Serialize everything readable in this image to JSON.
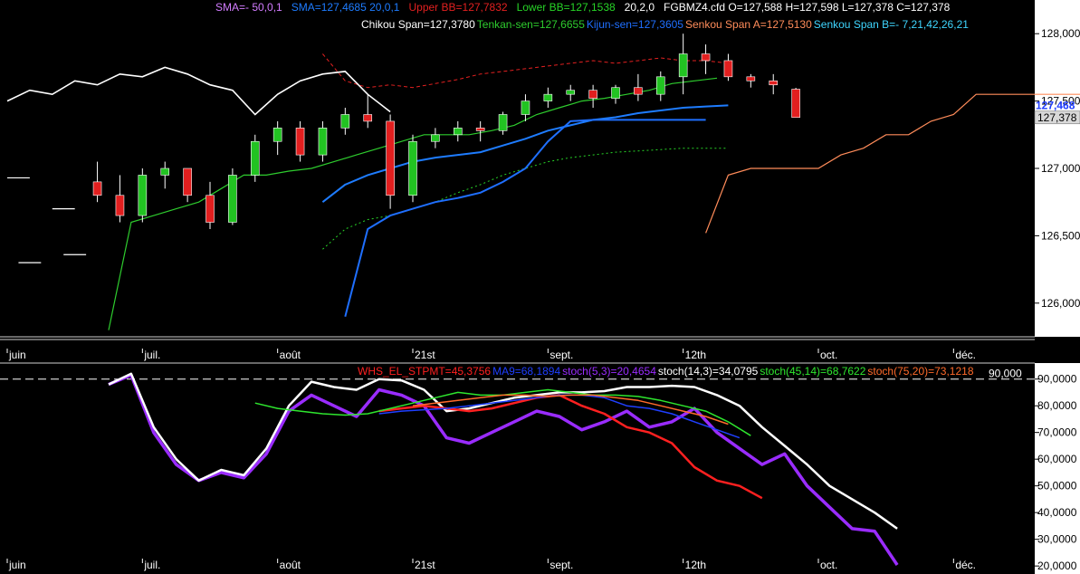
{
  "colors": {
    "background": "#000000",
    "axis_panel": "#ffffff",
    "bull_candle": "#22c322",
    "bear_candle": "#e21f1f",
    "sma50": "#d27cff",
    "sma20": "#1e7cff",
    "upper_bb": "#e22020",
    "lower_bb": "#27d427",
    "tenkan": "#2ecc2e",
    "kijun": "#1f6fff",
    "senkou_a": "#ff8c5a",
    "senkou_b": "#3fd6ff",
    "chikou": "#ffffff",
    "whs": "#ff2020",
    "ma9": "#1f3fff",
    "stoch_5_3": "#9a2cff",
    "stoch_14_3": "#ffffff",
    "stoch_45_14": "#2ee62e",
    "stoch_75_20": "#ff6a2a",
    "level_90": "#ffffff"
  },
  "top_legend": {
    "row1": [
      {
        "text": "SMA=-  50,0,1",
        "color": "#d27cff"
      },
      {
        "text": "SMA=127,4685  20,0,1",
        "color": "#1e7cff"
      },
      {
        "text": "Upper BB=127,7832",
        "color": "#e22020"
      },
      {
        "text": "Lower BB=127,1538",
        "color": "#27d427"
      },
      {
        "text": "20,2,0",
        "color": "#ffffff"
      },
      {
        "text": "FGBMZ4.cfd O=127,588 H=127,598 L=127,378 C=127,378",
        "color": "#ffffff"
      }
    ],
    "row2": [
      {
        "text": "Chikou Span=127,3780",
        "color": "#ffffff"
      },
      {
        "text": "Tenkan-sen=127,6655",
        "color": "#2ecc2e"
      },
      {
        "text": "Kijun-sen=127,3605",
        "color": "#1f6fff"
      },
      {
        "text": "Senkou Span A=127,5130",
        "color": "#ff8c5a"
      },
      {
        "text": "Senkou Span B=-  7,21,42,26,21",
        "color": "#3fd6ff"
      }
    ]
  },
  "bottom_legend": [
    {
      "text": "WHS_EL_STPMT=45,3756",
      "color": "#ff2020"
    },
    {
      "text": "MA9=68,1894",
      "color": "#1f3fff"
    },
    {
      "text": "stoch(5,3)=20,4654",
      "color": "#9a2cff"
    },
    {
      "text": "stoch(14,3)=34,0795",
      "color": "#ffffff"
    },
    {
      "text": "stoch(45,14)=68,7622",
      "color": "#2ee62e"
    },
    {
      "text": "stoch(75,20)=73,1218",
      "color": "#ff6a2a"
    }
  ],
  "chart_data": [
    {
      "type": "candlestick",
      "symbol": "FGBMZ4.cfd",
      "ylim": [
        125.75,
        128.25
      ],
      "y_ticks": [
        "128,000",
        "127,500",
        "127,000",
        "126,500",
        "126,000"
      ],
      "y_tick_values": [
        128.0,
        127.5,
        127.0,
        126.5,
        126.0
      ],
      "last_price_label": "127,378",
      "last_price": 127.378,
      "blue_marker_label": "127,468",
      "blue_marker": 127.468,
      "x_labels": [
        "juin",
        "juil.",
        "août",
        "21st",
        "sept.",
        "12th",
        "oct.",
        "déc."
      ],
      "x_label_index": [
        0,
        12,
        24,
        36,
        48,
        60,
        72,
        84
      ],
      "index_count": 90,
      "candles_ohlc": [
        [
          126.9,
          127.05,
          126.75,
          126.8
        ],
        [
          126.8,
          126.95,
          126.6,
          126.65
        ],
        [
          126.65,
          127.0,
          126.6,
          126.95
        ],
        [
          126.95,
          127.05,
          126.85,
          127.0
        ],
        [
          127.0,
          127.0,
          126.75,
          126.8
        ],
        [
          126.8,
          126.9,
          126.55,
          126.6
        ],
        [
          126.6,
          127.0,
          126.58,
          126.95
        ],
        [
          126.95,
          127.25,
          126.9,
          127.2
        ],
        [
          127.2,
          127.35,
          127.1,
          127.3
        ],
        [
          127.3,
          127.35,
          127.05,
          127.1
        ],
        [
          127.1,
          127.35,
          127.05,
          127.3
        ],
        [
          127.3,
          127.45,
          127.25,
          127.4
        ],
        [
          127.4,
          127.55,
          127.3,
          127.35
        ],
        [
          127.35,
          127.4,
          126.7,
          126.8
        ],
        [
          126.8,
          127.25,
          126.75,
          127.2
        ],
        [
          127.2,
          127.3,
          127.15,
          127.25
        ],
        [
          127.25,
          127.35,
          127.2,
          127.3
        ],
        [
          127.3,
          127.35,
          127.2,
          127.28
        ],
        [
          127.28,
          127.42,
          127.25,
          127.4
        ],
        [
          127.4,
          127.55,
          127.35,
          127.5
        ],
        [
          127.5,
          127.6,
          127.45,
          127.55
        ],
        [
          127.55,
          127.62,
          127.5,
          127.58
        ],
        [
          127.58,
          127.62,
          127.45,
          127.52
        ],
        [
          127.52,
          127.62,
          127.48,
          127.6
        ],
        [
          127.6,
          127.7,
          127.5,
          127.55
        ],
        [
          127.55,
          127.72,
          127.5,
          127.68
        ],
        [
          127.68,
          128.0,
          127.55,
          127.85
        ],
        [
          127.85,
          127.92,
          127.7,
          127.8
        ],
        [
          127.8,
          127.85,
          127.65,
          127.68
        ],
        [
          127.68,
          127.7,
          127.6,
          127.65
        ],
        [
          127.65,
          127.7,
          127.55,
          127.62
        ],
        [
          127.588,
          127.598,
          127.378,
          127.378
        ]
      ],
      "candle_start_index": 8,
      "candle_index_step": 2,
      "series": [
        {
          "name": "Upper BB",
          "start_index": 28,
          "step": 2,
          "values": [
            127.85,
            127.65,
            127.6,
            127.62,
            127.6,
            127.63,
            127.66,
            127.7,
            127.72,
            127.74,
            127.76,
            127.78,
            127.8,
            127.78,
            127.8,
            127.82,
            127.8,
            127.8,
            127.78
          ]
        },
        {
          "name": "Lower BB",
          "start_index": 28,
          "step": 2,
          "values": [
            126.4,
            126.55,
            126.62,
            126.65,
            126.7,
            126.75,
            126.82,
            126.88,
            126.95,
            127.0,
            127.05,
            127.08,
            127.1,
            127.12,
            127.13,
            127.14,
            127.15,
            127.15,
            127.15
          ]
        },
        {
          "name": "SMA 20",
          "start_index": 28,
          "step": 2,
          "values": [
            126.75,
            126.88,
            126.95,
            127.0,
            127.05,
            127.08,
            127.1,
            127.12,
            127.17,
            127.22,
            127.28,
            127.32,
            127.36,
            127.38,
            127.41,
            127.43,
            127.45,
            127.46,
            127.468
          ]
        },
        {
          "name": "Tenkan-sen",
          "start_index": 9,
          "step": 2,
          "values": [
            125.8,
            126.6,
            126.65,
            126.7,
            126.75,
            126.85,
            126.95,
            126.95,
            126.98,
            127.0,
            127.05,
            127.1,
            127.15,
            127.2,
            127.25,
            127.25,
            127.25,
            127.28,
            127.32,
            127.4,
            127.45,
            127.5,
            127.52,
            127.55,
            127.58,
            127.63,
            127.65,
            127.67
          ]
        },
        {
          "name": "Kijun-sen",
          "start_index": 30,
          "step": 2,
          "values": [
            125.9,
            126.55,
            126.65,
            126.7,
            126.75,
            126.78,
            126.82,
            126.9,
            127.0,
            127.2,
            127.35,
            127.36,
            127.36,
            127.36,
            127.36,
            127.36,
            127.36
          ]
        },
        {
          "name": "Chikou Span",
          "start_index": 0,
          "step": 2,
          "values": [
            127.5,
            127.58,
            127.55,
            127.65,
            127.62,
            127.7,
            127.68,
            127.75,
            127.7,
            127.62,
            127.58,
            127.4,
            127.55,
            127.65,
            127.7,
            127.72,
            127.55,
            127.42
          ]
        },
        {
          "name": "Senkou Span A",
          "start_index": 62,
          "step": 2,
          "values": [
            126.52,
            126.95,
            127.0,
            127.0,
            127.0,
            127.0,
            127.1,
            127.15,
            127.25,
            127.25,
            127.35,
            127.4,
            127.55,
            127.55,
            127.55,
            127.55,
            127.55,
            127.55,
            127.56
          ]
        }
      ],
      "marks": [
        {
          "name": "flat-mark",
          "from_index": 0,
          "to_index": 2,
          "value": 126.93
        },
        {
          "name": "flat-mark",
          "from_index": 4,
          "to_index": 6,
          "value": 126.7
        },
        {
          "name": "flat-mark",
          "from_index": 1,
          "to_index": 3,
          "value": 126.3
        },
        {
          "name": "flat-mark",
          "from_index": 5,
          "to_index": 7,
          "value": 126.36
        }
      ]
    },
    {
      "type": "line",
      "ylim": [
        17000,
        96000
      ],
      "y_ticks": [
        "90,0000",
        "80,0000",
        "70,0000",
        "60,0000",
        "50,0000",
        "40,0000",
        "30,0000",
        "20,0000"
      ],
      "y_tick_values": [
        90000,
        80000,
        70000,
        60000,
        50000,
        40000,
        30000,
        20000
      ],
      "x_labels": [
        "juin",
        "juil.",
        "août",
        "21st",
        "sept.",
        "12th",
        "oct.",
        "déc."
      ],
      "x_label_index": [
        0,
        12,
        24,
        36,
        48,
        60,
        72,
        84
      ],
      "index_count": 90,
      "level_line": {
        "value": 90000,
        "label": "90,000"
      },
      "series": [
        {
          "name": "stoch(5,3)",
          "start_index": 9,
          "step": 2,
          "width": 3.5,
          "values": [
            88000,
            91500,
            70000,
            58000,
            52000,
            55000,
            53000,
            62000,
            78000,
            84000,
            80000,
            76000,
            86000,
            84000,
            80000,
            68000,
            66000,
            70000,
            74000,
            78000,
            76000,
            71000,
            74000,
            78000,
            72000,
            74000,
            79000,
            70000,
            64000,
            58000,
            62000,
            50000,
            42000,
            34000,
            33000,
            20400
          ]
        },
        {
          "name": "stoch(14,3)",
          "start_index": 9,
          "step": 2,
          "width": 2.5,
          "values": [
            88000,
            92000,
            72000,
            60000,
            52000,
            56000,
            54000,
            64000,
            80000,
            89000,
            87000,
            86000,
            90000,
            89500,
            86000,
            78000,
            79000,
            81000,
            83000,
            84000,
            85000,
            85000,
            85500,
            87000,
            87000,
            87500,
            87000,
            84000,
            80000,
            72000,
            65000,
            58000,
            50000,
            45000,
            40000,
            34000
          ]
        },
        {
          "name": "WHS_EL_STPMT",
          "start_index": 33,
          "step": 2,
          "width": 2.5,
          "values": [
            78000,
            79000,
            80000,
            79000,
            78000,
            79000,
            81000,
            83000,
            84000,
            80000,
            77000,
            72000,
            70000,
            66000,
            57000,
            52000,
            50000,
            45400
          ]
        },
        {
          "name": "MA9",
          "start_index": 33,
          "step": 2,
          "width": 1.5,
          "values": [
            77000,
            78000,
            78500,
            79000,
            80000,
            81000,
            82000,
            83000,
            84000,
            84000,
            83000,
            80000,
            79000,
            77000,
            74000,
            71000,
            68000
          ]
        },
        {
          "name": "stoch(45,14)",
          "start_index": 22,
          "step": 2,
          "width": 1.5,
          "values": [
            81000,
            79000,
            78000,
            77000,
            76500,
            77000,
            79000,
            81000,
            83000,
            85000,
            84000,
            84000,
            85000,
            86000,
            85000,
            84000,
            84000,
            83500,
            82000,
            80000,
            78000,
            74000,
            68800
          ]
        },
        {
          "name": "stoch(75,20)",
          "start_index": 36,
          "step": 2,
          "width": 1.5,
          "values": [
            80000,
            81000,
            82000,
            83000,
            84000,
            84000,
            83500,
            84000,
            84000,
            83000,
            82000,
            80000,
            78000,
            76000,
            73100
          ]
        }
      ]
    }
  ]
}
